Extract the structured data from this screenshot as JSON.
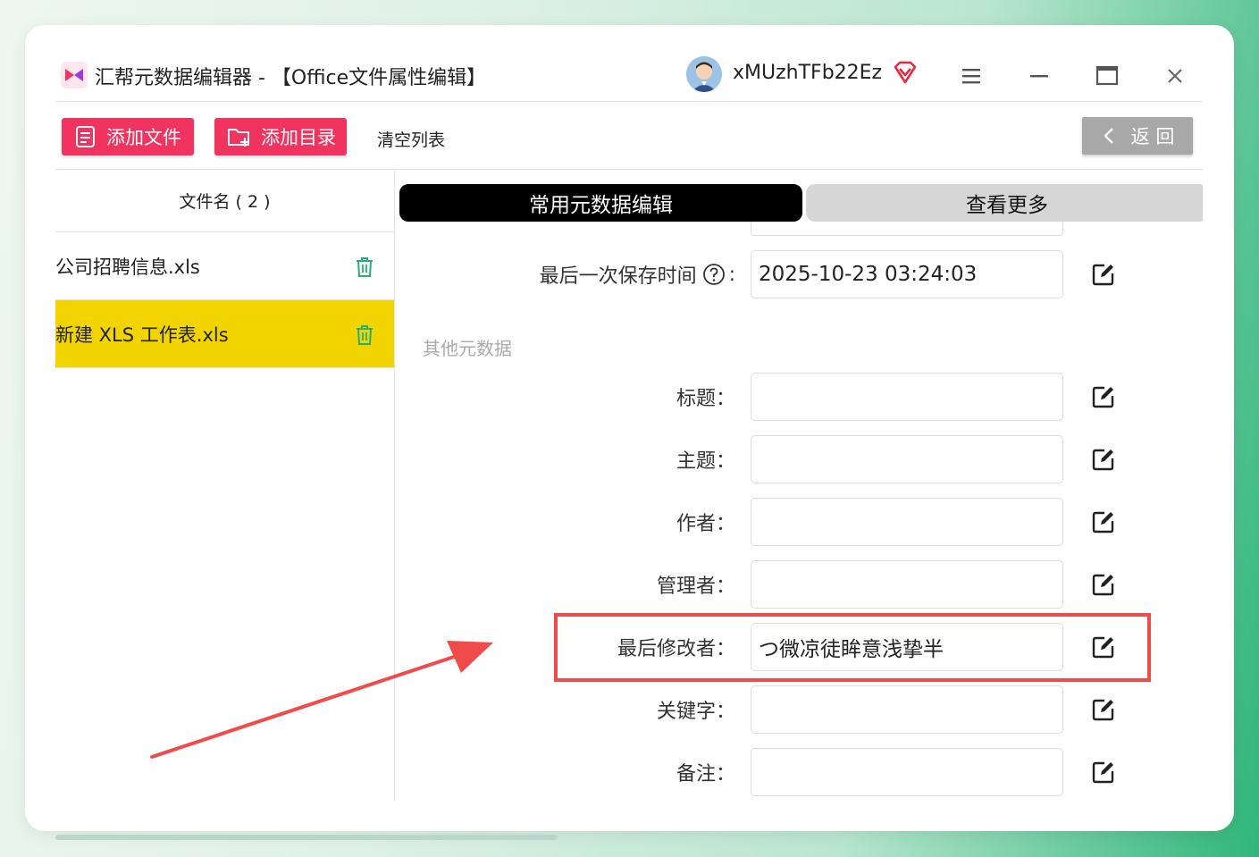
{
  "window": {
    "title": "汇帮元数据编辑器 - 【Office文件属性编辑】",
    "username": "xMUzhTFb22Ez",
    "colors": {
      "accent": "#f0345f",
      "selected_row": "#f2d500",
      "highlight": "#ef4b4b",
      "tab_active": "#000000"
    }
  },
  "toolbar": {
    "add_file": "添加文件",
    "add_dir": "添加目录",
    "clear": "清空列表",
    "back": "返 回"
  },
  "file_list": {
    "header": "文件名 ( 2 )",
    "items": [
      {
        "name": "公司招聘信息.xls",
        "selected": false
      },
      {
        "name": "新建 XLS 工作表.xls",
        "selected": true
      }
    ]
  },
  "tabs": {
    "common": "常用元数据编辑",
    "more": "查看更多"
  },
  "metadata": {
    "last_saved": {
      "label": "最后一次保存时间",
      "value": "2025-10-23 03:24:03"
    },
    "other_section": "其他元数据",
    "fields": [
      {
        "label": "标题：",
        "value": ""
      },
      {
        "label": "主题：",
        "value": ""
      },
      {
        "label": "作者：",
        "value": ""
      },
      {
        "label": "管理者：",
        "value": ""
      },
      {
        "label": "最后修改者：",
        "value": "つ微凉徒眸意浅挚半"
      },
      {
        "label": "关键字：",
        "value": ""
      },
      {
        "label": "备注：",
        "value": ""
      }
    ]
  }
}
